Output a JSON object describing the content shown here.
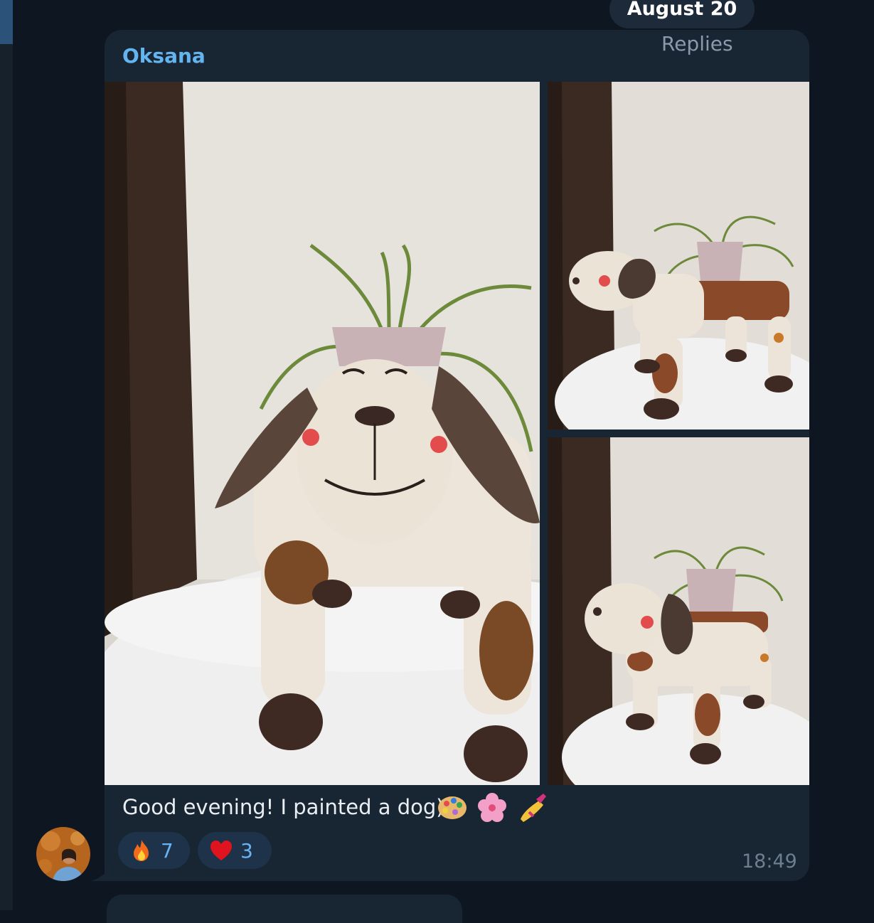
{
  "date_separator": "August 20",
  "message": {
    "sender": "Oksana",
    "replies_label": "Replies",
    "caption": "Good evening! I painted a dog)",
    "caption_emojis": [
      "artist-palette-emoji",
      "cherry-blossom-emoji",
      "nail-polish-emoji"
    ],
    "time": "18:49",
    "photos": [
      {
        "name": "photo-dog-front",
        "alt": "Papier-mache dog planter, front view"
      },
      {
        "name": "photo-dog-side-1",
        "alt": "Papier-mache dog planter, side view"
      },
      {
        "name": "photo-dog-side-2",
        "alt": "Papier-mache dog planter, angled view"
      }
    ],
    "reactions": [
      {
        "icon": "fire-icon",
        "count": "7"
      },
      {
        "icon": "red-heart-icon",
        "count": "3"
      }
    ]
  },
  "colors": {
    "background": "#0e1621",
    "bubble": "#182533",
    "sender_name": "#64b5ef",
    "reaction_bg": "#1e3349",
    "reaction_count": "#6ab3f3",
    "time": "#6d7f8f"
  }
}
